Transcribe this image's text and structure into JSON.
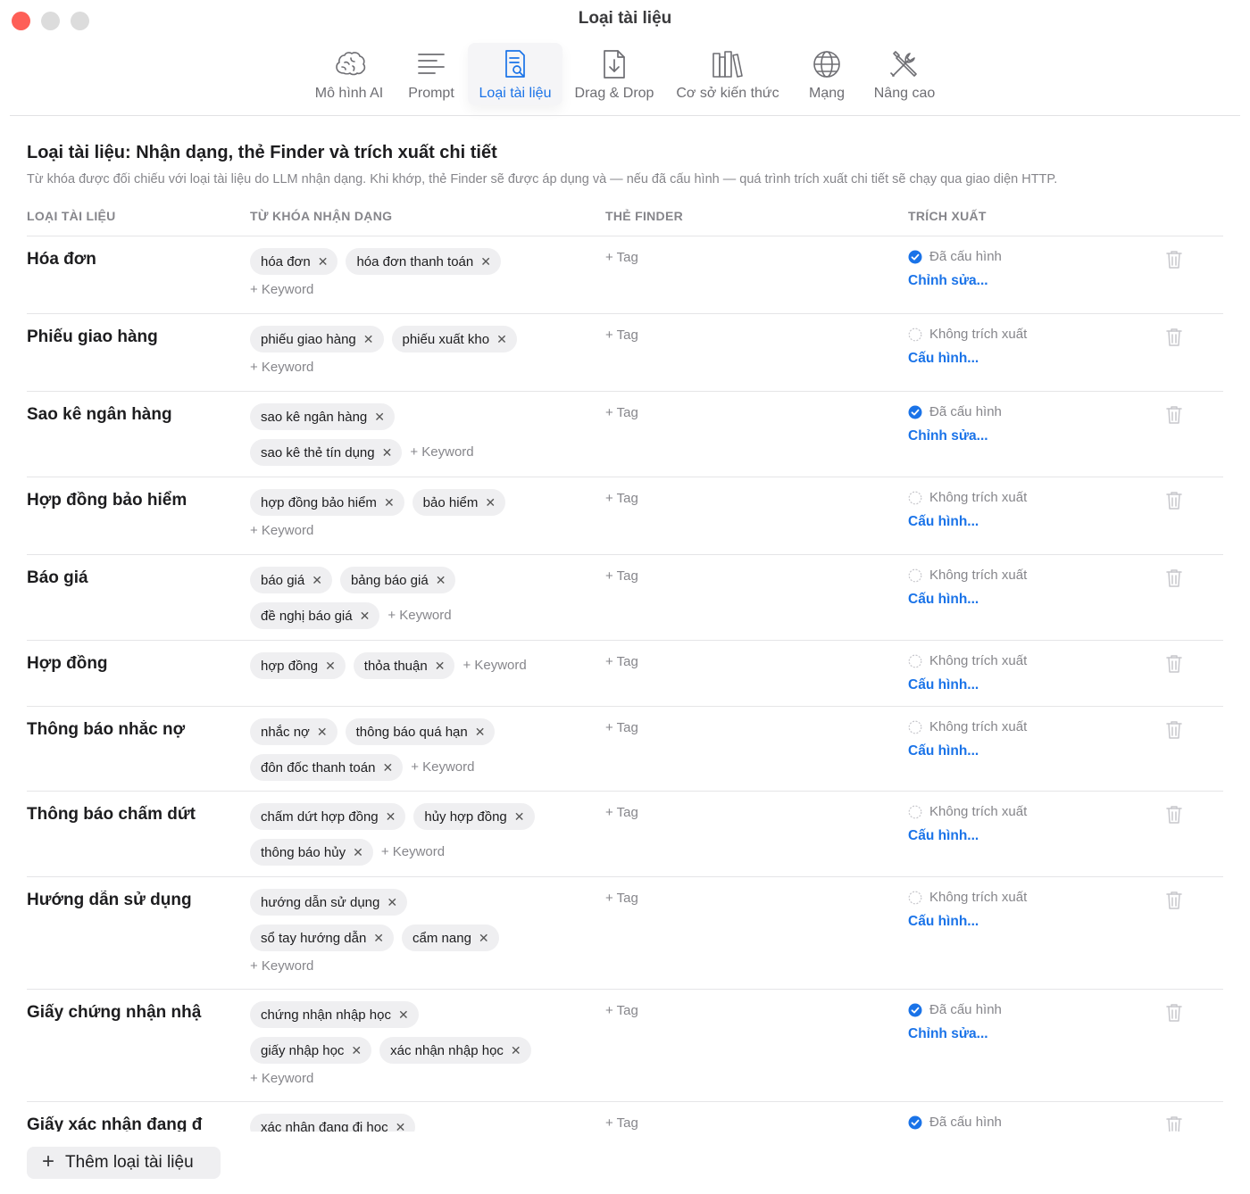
{
  "window": {
    "title": "Loại tài liệu"
  },
  "toolbar": {
    "items": [
      {
        "label": "Mô hình AI",
        "icon": "brain-icon"
      },
      {
        "label": "Prompt",
        "icon": "text-lines-icon"
      },
      {
        "label": "Loại tài liệu",
        "icon": "document-search-icon",
        "active": true
      },
      {
        "label": "Drag & Drop",
        "icon": "document-download-icon"
      },
      {
        "label": "Cơ sở kiến thức",
        "icon": "books-icon"
      },
      {
        "label": "Mạng",
        "icon": "globe-icon"
      },
      {
        "label": "Nâng cao",
        "icon": "tools-icon"
      }
    ]
  },
  "header": {
    "title": "Loại tài liệu: Nhận dạng, thẻ Finder và trích xuất chi tiết",
    "description": "Từ khóa được đối chiếu với loại tài liệu do LLM nhận dạng. Khi khớp, thẻ Finder sẽ được áp dụng và — nếu đã cấu hình — quá trình trích xuất chi tiết sẽ chạy qua giao diện HTTP."
  },
  "table": {
    "columns": {
      "type": "LOẠI TÀI LIỆU",
      "keywords": "TỪ KHÓA NHẬN DẠNG",
      "finder": "THẺ FINDER",
      "extract": "TRÍCH XUẤT"
    },
    "add_keyword_label": "+ Keyword",
    "add_tag_label": "+ Tag",
    "status_configured": "Đã cấu hình",
    "status_not_configured": "Không trích xuất",
    "link_edit": "Chỉnh sửa...",
    "link_configure": "Cấu hình...",
    "rows": [
      {
        "name": "Hóa đơn",
        "keywords": [
          "hóa đơn",
          "hóa đơn thanh toán"
        ],
        "configured": true
      },
      {
        "name": "Phiếu giao hàng",
        "keywords": [
          "phiếu giao hàng",
          "phiếu xuất kho"
        ],
        "configured": false
      },
      {
        "name": "Sao kê ngân hàng",
        "keywords": [
          "sao kê ngân hàng",
          "sao kê thẻ tín dụng"
        ],
        "configured": true
      },
      {
        "name": "Hợp đồng bảo hiểm",
        "keywords": [
          "hợp đồng bảo hiểm",
          "bảo hiểm"
        ],
        "configured": false
      },
      {
        "name": "Báo giá",
        "keywords": [
          "báo giá",
          "bảng báo giá",
          "đề nghị báo giá"
        ],
        "configured": false
      },
      {
        "name": "Hợp đồng",
        "keywords": [
          "hợp đồng",
          "thỏa thuận"
        ],
        "configured": false
      },
      {
        "name": "Thông báo nhắc nợ",
        "keywords": [
          "nhắc nợ",
          "thông báo quá hạn",
          "đôn đốc thanh toán"
        ],
        "configured": false
      },
      {
        "name": "Thông báo chấm dứt",
        "keywords": [
          "chấm dứt hợp đồng",
          "hủy hợp đồng",
          "thông báo hủy"
        ],
        "configured": false
      },
      {
        "name": "Hướng dẫn sử dụng",
        "keywords": [
          "hướng dẫn sử dụng",
          "sổ tay hướng dẫn",
          "cẩm nang"
        ],
        "configured": false
      },
      {
        "name": "Giấy chứng nhận nhậ",
        "keywords": [
          "chứng nhận nhập học",
          "giấy nhập học",
          "xác nhận nhập học"
        ],
        "configured": true
      },
      {
        "name": "Giấy xác nhận đang đ",
        "keywords": [
          "xác nhận đang đi học"
        ],
        "configured": true
      }
    ]
  },
  "footer": {
    "add_type_label": "Thêm loại tài liệu"
  },
  "colors": {
    "accent": "#1a73e8",
    "close": "#fe5f57",
    "chip_bg": "#efeff1",
    "muted": "#86868b"
  }
}
